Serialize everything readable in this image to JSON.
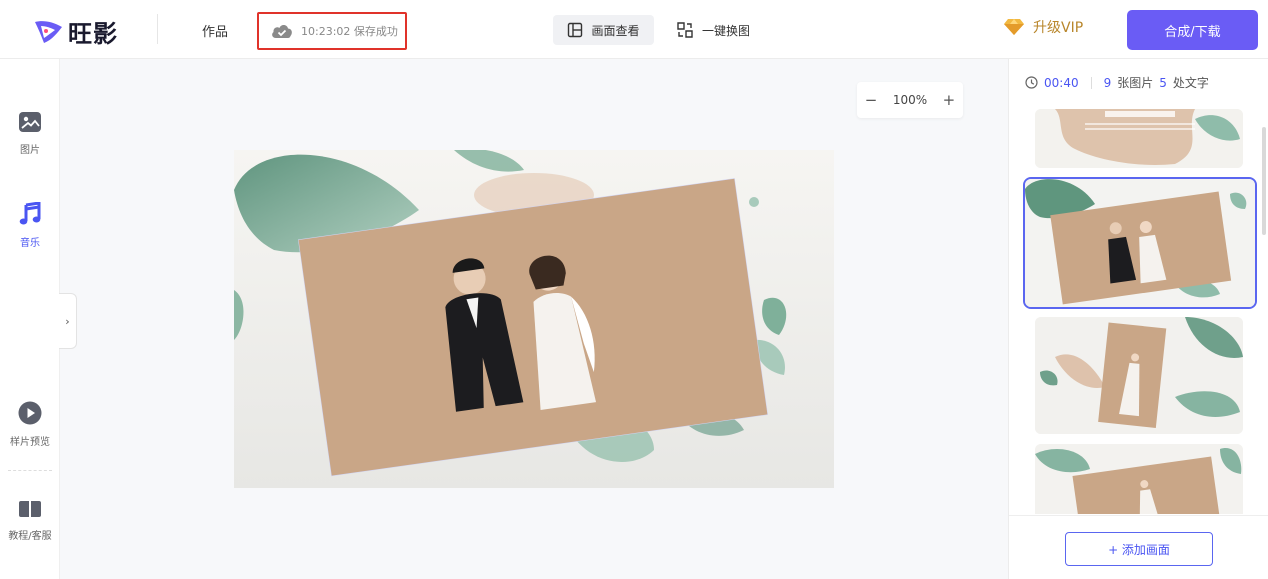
{
  "header": {
    "logo_text": "旺影",
    "works_label": "作品",
    "save_status": "10:23:02 保存成功",
    "view_label": "画面查看",
    "swap_label": "一键换图",
    "vip_label": "升级VIP",
    "download_label": "合成/下载"
  },
  "sidebar": {
    "items": [
      {
        "label": "图片",
        "icon": "image-icon"
      },
      {
        "label": "音乐",
        "icon": "music-icon"
      },
      {
        "label": "样片预览",
        "icon": "play-icon"
      },
      {
        "label": "教程/客服",
        "icon": "book-icon"
      }
    ],
    "collapse_glyph": "›"
  },
  "canvas": {
    "zoom_minus": "−",
    "zoom_level": "100%",
    "zoom_plus": "+"
  },
  "panel": {
    "duration": "00:40",
    "image_count": "9",
    "image_unit": "张图片",
    "text_count": "5",
    "text_unit": "处文字",
    "add_label": "+ 添加画面"
  },
  "colors": {
    "accent": "#6a5cf5",
    "active_blue": "#4a55f2",
    "highlight_red": "#e0332a",
    "vip_gold": "#b8862b"
  }
}
